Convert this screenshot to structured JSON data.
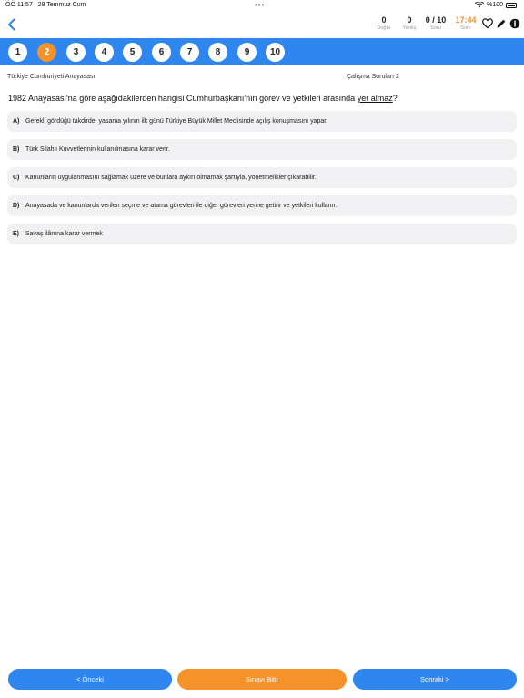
{
  "status_bar": {
    "time": "ÖÖ 11:57",
    "date": "28 Temmuz Cum",
    "battery": "%100"
  },
  "header": {
    "stats": [
      {
        "value": "0",
        "label": "Doğru"
      },
      {
        "value": "0",
        "label": "Yanlış"
      },
      {
        "value": "0 / 10",
        "label": "Soru"
      },
      {
        "value": "17:44",
        "label": "Süre"
      }
    ],
    "icons": [
      "heart-icon",
      "pencil-icon",
      "alert-icon"
    ],
    "accent_color": "#2f86ee",
    "highlight_color": "#f5922a"
  },
  "question_nav": {
    "numbers": [
      "1",
      "2",
      "3",
      "4",
      "5",
      "6",
      "7",
      "8",
      "9",
      "10"
    ],
    "active_index": 1
  },
  "subject": "Türkiye Cumhuriyeti Anayasası",
  "series": "Çalışma Soruları 2",
  "question": {
    "text_before": "1982 Anayasası'na göre aşağıdakilerden hangisi Cumhurbaşkanı'nın görev ve yetkileri arasında ",
    "text_underlined": "yer almaz",
    "text_after": "?"
  },
  "options": [
    {
      "letter": "A)",
      "text": "Gerekli gördüğü takdirde, yasama yılının ilk günü Türkiye Büyük Millet Meclisinde açılış konuşmasını yapar."
    },
    {
      "letter": "B)",
      "text": "Türk Silahlı Kuvvetlerinin kullanılmasına karar verir."
    },
    {
      "letter": "C)",
      "text": "Kanunların uygulanmasını sağlamak üzere ve bunlara aykırı olmamak şartıyla, yönetmelikler çıkarabilir."
    },
    {
      "letter": "D)",
      "text": "Anayasada ve kanunlarda verilen seçme ve atama görevleri ile diğer görevleri yerine getirir ve yetkileri kullanır."
    },
    {
      "letter": "E)",
      "text": "Savaş ilânına karar vermek"
    }
  ],
  "footer": {
    "prev_label": "< Önceki",
    "finish_label": "Sınavı Bitir",
    "next_label": "Sonraki >"
  }
}
